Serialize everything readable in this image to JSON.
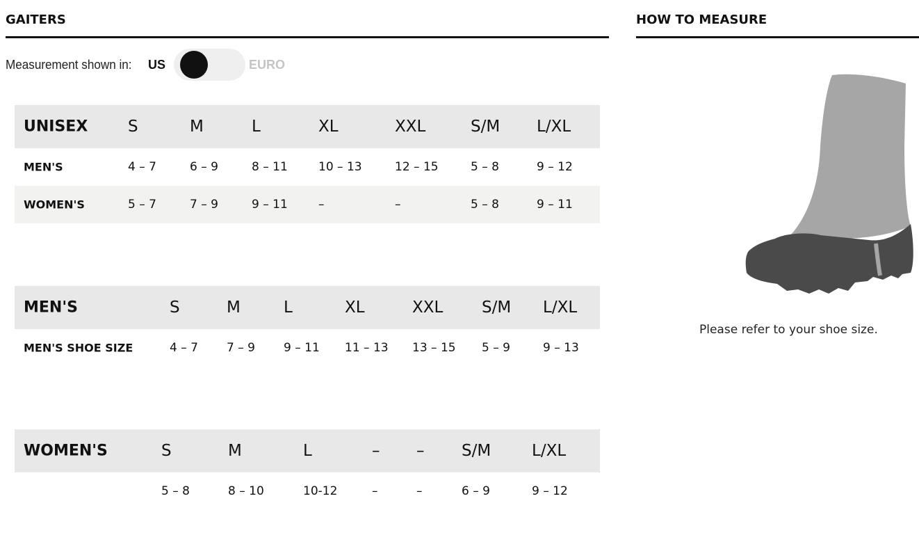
{
  "sections": {
    "gaiters_title": "GAITERS",
    "how_to_measure_title": "HOW TO MEASURE"
  },
  "measurement": {
    "label": "Measurement shown in:",
    "us": "US",
    "euro": "EURO",
    "selected": "US"
  },
  "tables": {
    "unisex": {
      "headers": [
        "UNISEX",
        "S",
        "M",
        "L",
        "XL",
        "XXL",
        "S/M",
        "L/XL"
      ],
      "rows": [
        [
          "MEN'S",
          "4 – 7",
          "6 – 9",
          "8 – 11",
          "10 – 13",
          "12 – 15",
          "5 – 8",
          "9 – 12"
        ],
        [
          "WOMEN'S",
          "5 – 7",
          "7 – 9",
          "9 – 11",
          "–",
          "–",
          "5 – 8",
          "9 – 11"
        ]
      ]
    },
    "mens": {
      "headers": [
        "MEN'S",
        "S",
        "M",
        "L",
        "XL",
        "XXL",
        "S/M",
        "L/XL"
      ],
      "rows": [
        [
          "MEN'S SHOE SIZE",
          "4 – 7",
          "7 – 9",
          "9 – 11",
          "11 – 13",
          "13 – 15",
          "5 – 9",
          "9 – 13"
        ]
      ]
    },
    "womens": {
      "headers": [
        "WOMEN'S",
        "S",
        "M",
        "L",
        "–",
        "–",
        "S/M",
        "L/XL"
      ],
      "rows": [
        [
          "",
          "5 – 8",
          "8 – 10",
          "10-12",
          "–",
          "–",
          "6 – 9",
          "9 – 12"
        ]
      ]
    }
  },
  "how_to_measure": {
    "illustration": "gaiter-boot-icon",
    "text": "Please refer to your shoe size."
  },
  "colors": {
    "header_bg": "#e8e8e8",
    "shade_bg": "#f2f2f0",
    "gaiter": "#a6a6a6",
    "boot": "#4a4a4a"
  }
}
